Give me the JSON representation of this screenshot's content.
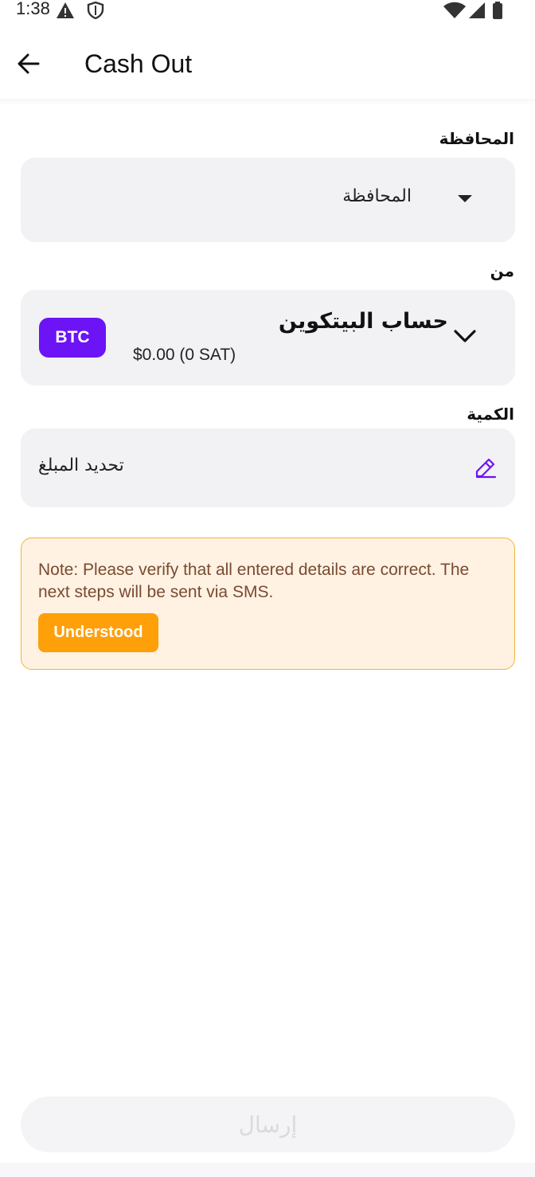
{
  "status_bar": {
    "time": "1:38",
    "left_icons": [
      "alert-triangle-icon",
      "shield-icon"
    ],
    "right_icons": [
      "wifi-icon",
      "cellular-signal-icon",
      "battery-icon"
    ]
  },
  "header": {
    "back_icon": "arrow-left-icon",
    "title": "Cash Out"
  },
  "form": {
    "wallet": {
      "label": "المحافظة",
      "selected_value": "المحافظة",
      "dropdown_icon": "dropdown-triangle-icon"
    },
    "from": {
      "label": "من",
      "currency_badge": "BTC",
      "account_name": "حساب البيتكوين",
      "balance": "$0.00 (0 SAT)",
      "dropdown_icon": "chevron-down-icon"
    },
    "amount": {
      "label": "الكمية",
      "placeholder": "تحديد المبلغ",
      "edit_icon": "pencil-icon"
    }
  },
  "note": {
    "text": "Note: Please verify that all entered details are correct. The next steps will be sent via SMS.",
    "button_label": "Understood"
  },
  "submit": {
    "label": "إرسال",
    "enabled": false
  },
  "colors": {
    "accent": "#6c14f5",
    "warning": "#ff9f0a",
    "warning_bg": "#fff2e3",
    "field_bg": "#f2f2f4"
  }
}
